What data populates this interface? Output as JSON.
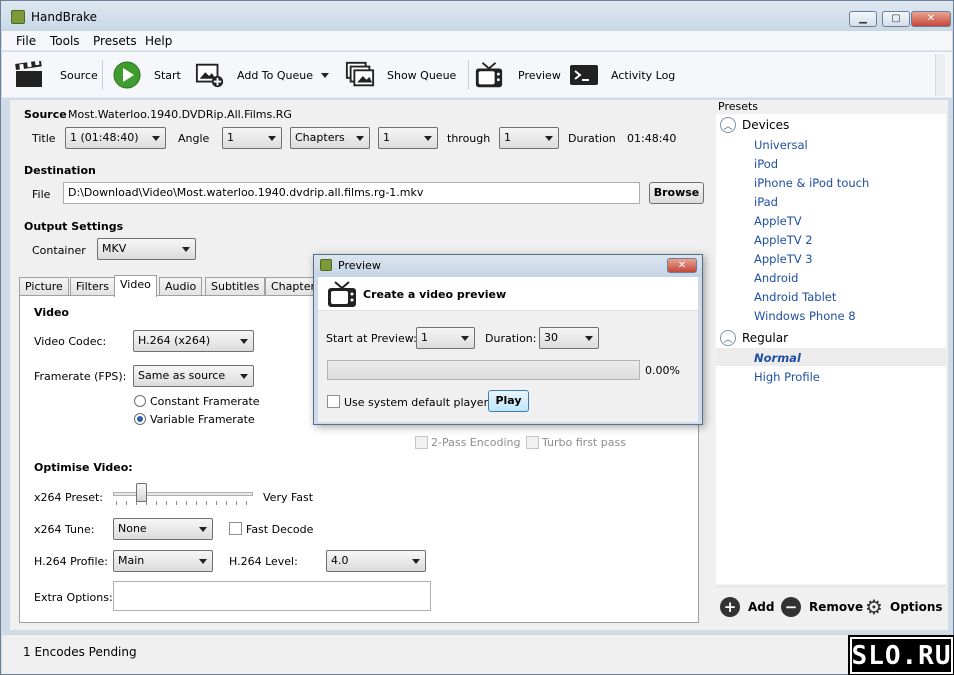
{
  "window": {
    "title": "HandBrake"
  },
  "menu": [
    "File",
    "Tools",
    "Presets",
    "Help"
  ],
  "toolbar": {
    "source": "Source",
    "start": "Start",
    "add_to_queue": "Add To Queue",
    "show_queue": "Show Queue",
    "preview": "Preview",
    "activity_log": "Activity Log"
  },
  "source": {
    "label": "Source",
    "value": "Most.Waterloo.1940.DVDRip.All.Films.RG",
    "title_label": "Title",
    "title_value": "1 (01:48:40)",
    "angle_label": "Angle",
    "angle_value": "1",
    "chapters_mode": "Chapters",
    "chapter_start": "1",
    "through_label": "through",
    "chapter_end": "1",
    "duration_label": "Duration",
    "duration_value": "01:48:40"
  },
  "destination": {
    "label": "Destination",
    "file_label": "File",
    "file_value": "D:\\Download\\Video\\Most.waterloo.1940.dvdrip.all.films.rg-1.mkv",
    "browse": "Browse"
  },
  "output": {
    "label": "Output Settings",
    "container_label": "Container",
    "container_value": "MKV"
  },
  "tabs": [
    "Picture",
    "Filters",
    "Video",
    "Audio",
    "Subtitles",
    "Chapters"
  ],
  "video": {
    "section": "Video",
    "codec_label": "Video Codec:",
    "codec_value": "H.264 (x264)",
    "framerate_label": "Framerate (FPS):",
    "framerate_value": "Same as source",
    "constant": "Constant Framerate",
    "variable": "Variable Framerate",
    "two_pass": "2-Pass Encoding",
    "turbo": "Turbo first pass"
  },
  "optimise": {
    "section": "Optimise Video:",
    "preset_label": "x264 Preset:",
    "preset_value": "Very Fast",
    "preset_level": 0.17,
    "tune_label": "x264 Tune:",
    "tune_value": "None",
    "fast_decode": "Fast Decode",
    "profile_label": "H.264 Profile:",
    "profile_value": "Main",
    "level_label": "H.264 Level:",
    "level_value": "4.0",
    "extra_label": "Extra Options:"
  },
  "dialog": {
    "title": "Preview",
    "heading": "Create a video preview",
    "start_label": "Start at Preview:",
    "start_value": "1",
    "duration_label": "Duration:",
    "duration_value": "30",
    "progress_text": "0.00%",
    "progress": 0,
    "system_player": "Use system default player",
    "play": "Play"
  },
  "presets": {
    "title": "Presets",
    "groups": [
      {
        "name": "Devices",
        "items": [
          "Universal",
          "iPod",
          "iPhone & iPod touch",
          "iPad",
          "AppleTV",
          "AppleTV 2",
          "AppleTV 3",
          "Android",
          "Android Tablet",
          "Windows Phone 8"
        ]
      },
      {
        "name": "Regular",
        "items": [
          "Normal",
          "High Profile"
        ]
      }
    ],
    "selected": "Normal",
    "add": "Add",
    "remove": "Remove",
    "options": "Options"
  },
  "status": {
    "text": "1 Encodes Pending"
  },
  "watermark": "SLO.RU"
}
